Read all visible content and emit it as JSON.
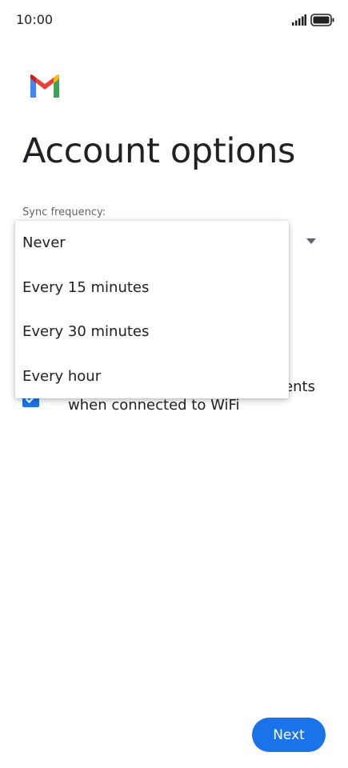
{
  "status_bar": {
    "time": "10:00",
    "signal_icon": "signal-bars-icon",
    "battery_icon": "battery-full-icon"
  },
  "app": {
    "logo_icon": "gmail-logo-icon",
    "brand_colors": {
      "blue": "#4285F4",
      "red": "#EA4335",
      "yellow": "#FBBC04",
      "green": "#34A853"
    }
  },
  "page": {
    "title": "Account options",
    "sync_label": "Sync frequency:"
  },
  "dropdown": {
    "options": [
      {
        "label": "Never"
      },
      {
        "label": "Every 15 minutes"
      },
      {
        "label": "Every 30 minutes"
      },
      {
        "label": "Every hour"
      }
    ]
  },
  "checkbox": {
    "checked": true,
    "label_visible_part1": "ents",
    "label_visible_part2": "when connected to WiFi"
  },
  "footer": {
    "next_label": "Next"
  },
  "colors": {
    "accent": "#1a73e8",
    "text_primary": "#202124",
    "text_secondary": "#5f6368"
  }
}
